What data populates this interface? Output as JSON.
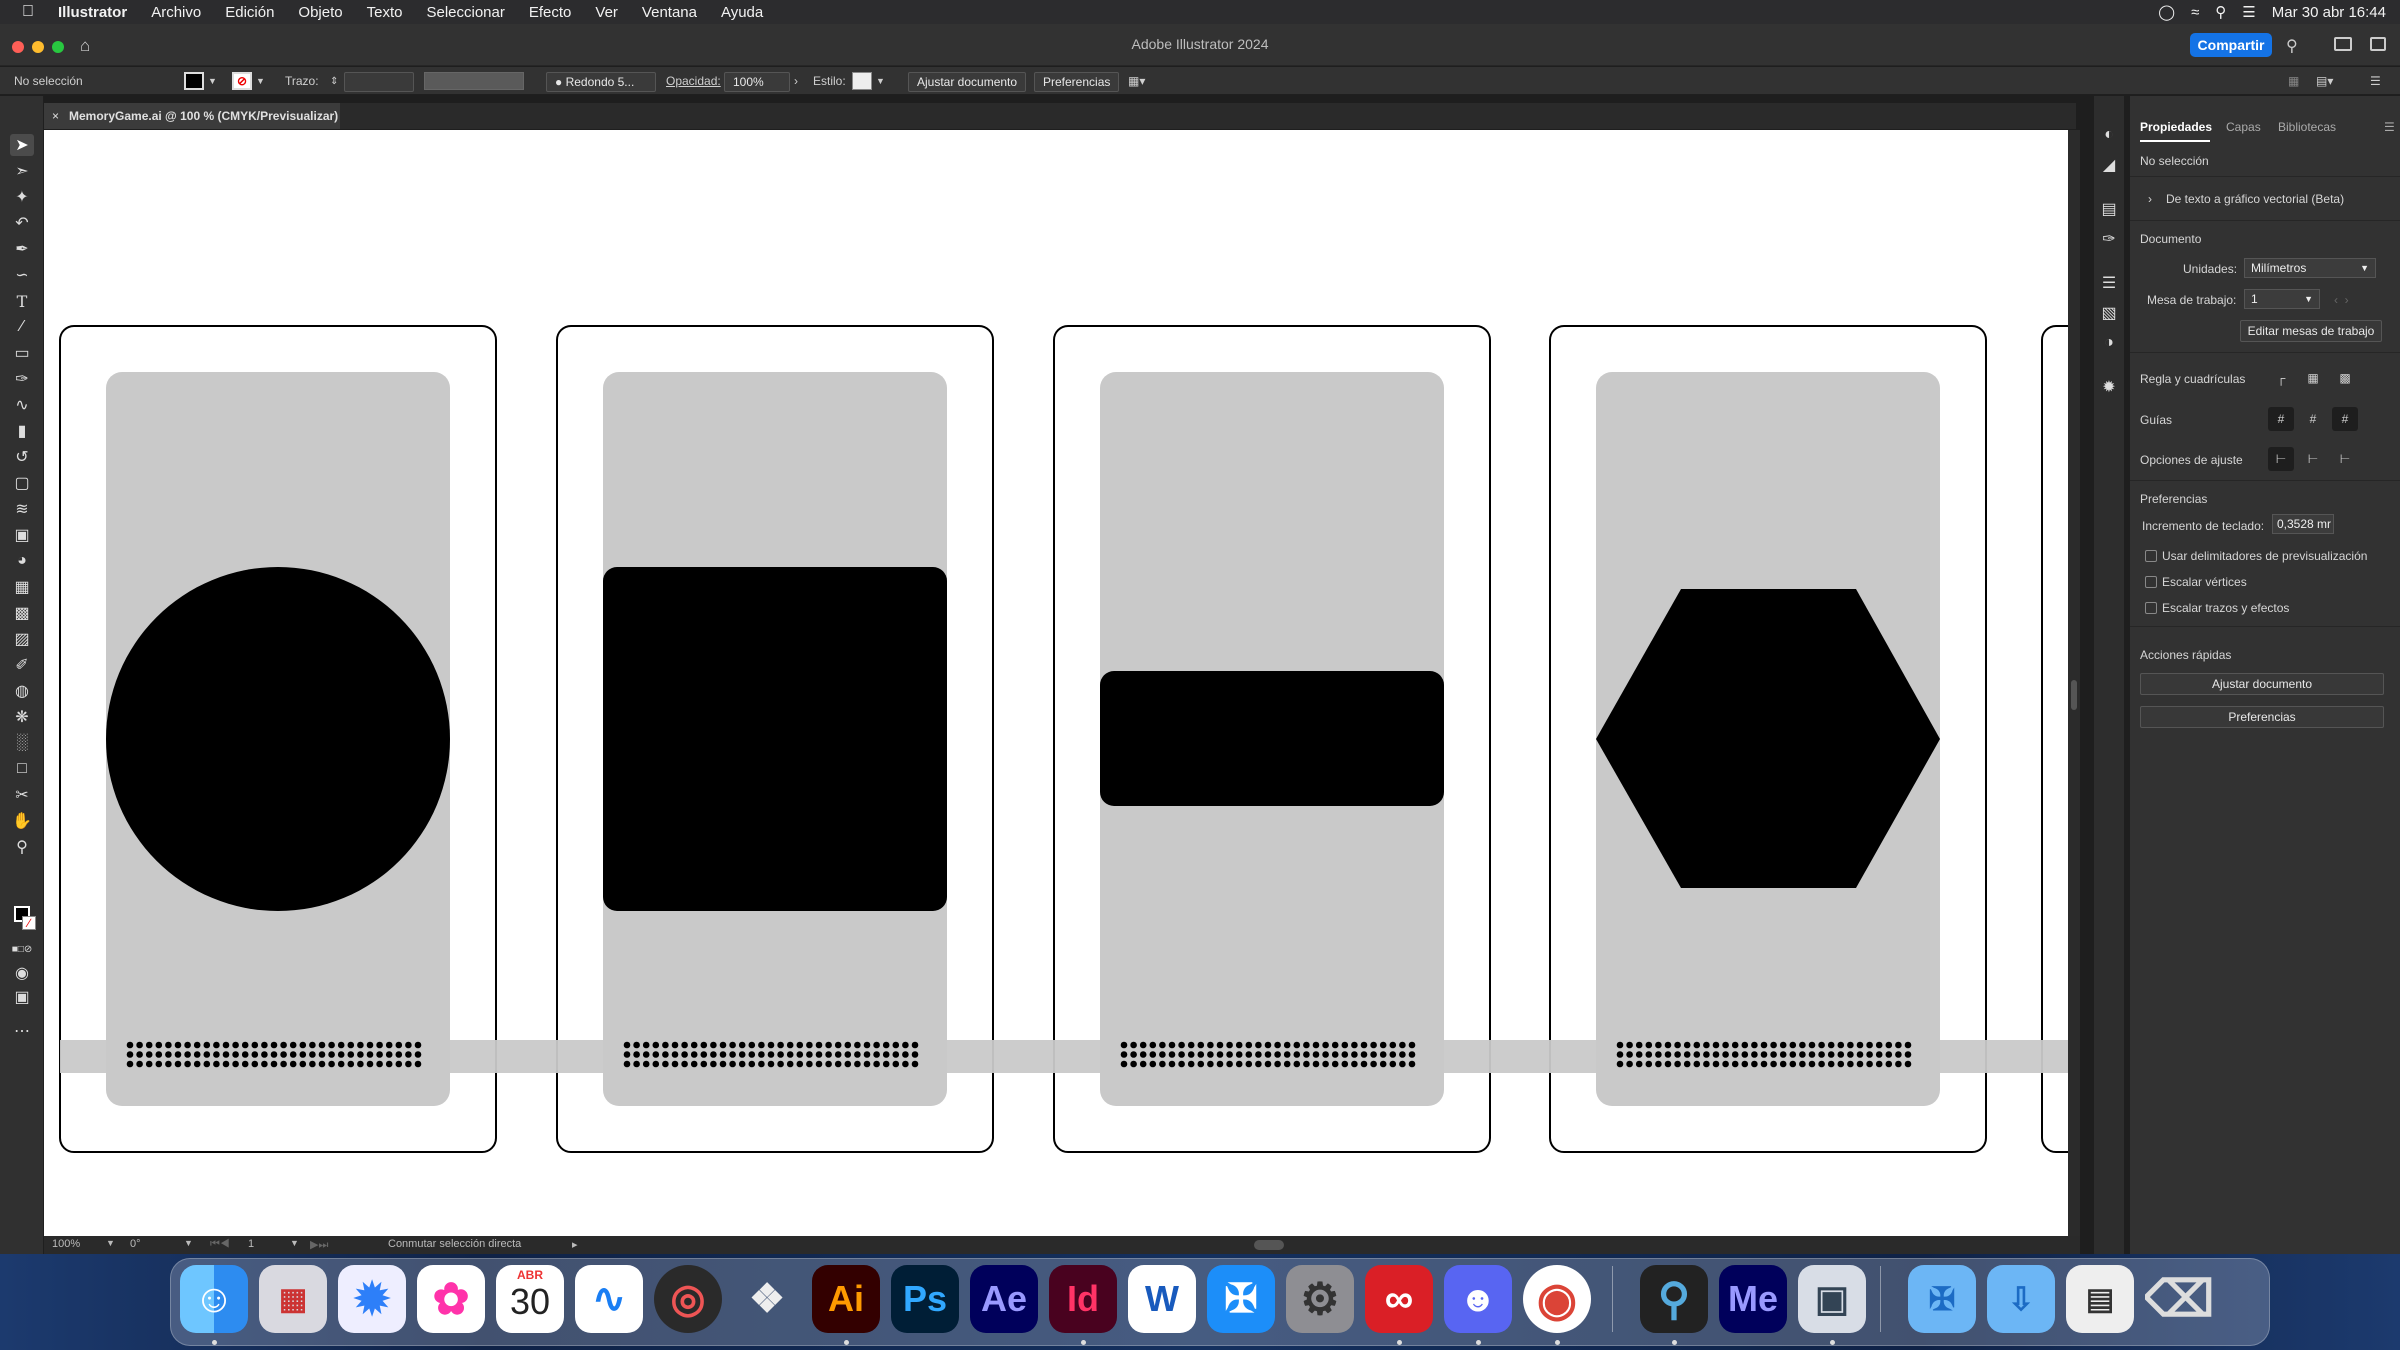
{
  "menubar": {
    "app_name": "Illustrator",
    "items": [
      "Archivo",
      "Edición",
      "Objeto",
      "Texto",
      "Seleccionar",
      "Efecto",
      "Ver",
      "Ventana",
      "Ayuda"
    ],
    "clock": "Mar 30 abr 16:44"
  },
  "window": {
    "title": "Adobe Illustrator 2024",
    "share_label": "Compartir"
  },
  "control_bar": {
    "selection": "No selección",
    "stroke_label": "Trazo:",
    "brush": "Redondo 5...",
    "opacity_label": "Opacidad:",
    "opacity_value": "100%",
    "style_label": "Estilo:",
    "fit_doc": "Ajustar documento",
    "prefs": "Preferencias"
  },
  "document_tab": {
    "close_glyph": "×",
    "label": "MemoryGame.ai @ 100 % (CMYK/Previsualizar)"
  },
  "status_bar": {
    "zoom": "100%",
    "rotation": "0°",
    "artboard": "1",
    "tool_status": "Conmutar selección directa"
  },
  "properties_panel": {
    "tabs": [
      "Propiedades",
      "Capas",
      "Bibliotecas"
    ],
    "selection_state": "No selección",
    "vector_ai": "De texto a gráfico vectorial (Beta)",
    "document_heading": "Documento",
    "units_label": "Unidades:",
    "units_value": "Milímetros",
    "artboard_label": "Mesa de trabajo:",
    "artboard_value": "1",
    "edit_artboards": "Editar mesas de trabajo",
    "rulers_label": "Regla y cuadrículas",
    "guides_label": "Guías",
    "snap_label": "Opciones de ajuste",
    "prefs_heading": "Preferencias",
    "keyboard_increment_label": "Incremento de teclado:",
    "keyboard_increment_value": "0,3528 mr",
    "checkboxes": [
      "Usar delimitadores de previsualización",
      "Escalar vértices",
      "Escalar trazos y efectos"
    ],
    "quick_actions_heading": "Acciones rápidas",
    "quick_actions": [
      "Ajustar documento",
      "Preferencias"
    ]
  },
  "artwork": {
    "cards": [
      {
        "shape": "circle"
      },
      {
        "shape": "rounded-square"
      },
      {
        "shape": "rounded-bar"
      },
      {
        "shape": "hexagon"
      }
    ],
    "colors": {
      "card_bg": "#c9c9c9",
      "shape": "#000000",
      "stripe": "#c9c9c9"
    }
  },
  "dock": {
    "calendar_month": "ABR",
    "calendar_day": "30",
    "apps": [
      "Finder",
      "Launchpad",
      "Safari",
      "Fotos",
      "Calendario",
      "Freeform",
      "Digital Color Meter",
      "Rhinoceros 8",
      "Illustrator",
      "Photoshop",
      "After Effects",
      "InDesign",
      "Word",
      "App Store",
      "Configuración del Sistema",
      "Creative Cloud",
      "Discord",
      "Chrome",
      "QuickTime",
      "Media Encoder",
      "Preview",
      "Aplicaciones",
      "Descargas",
      "Recientes",
      "Papelera"
    ],
    "labels": {
      "ai": "Ai",
      "ps": "Ps",
      "ae": "Ae",
      "id": "Id",
      "me": "Me",
      "word": "W"
    }
  }
}
